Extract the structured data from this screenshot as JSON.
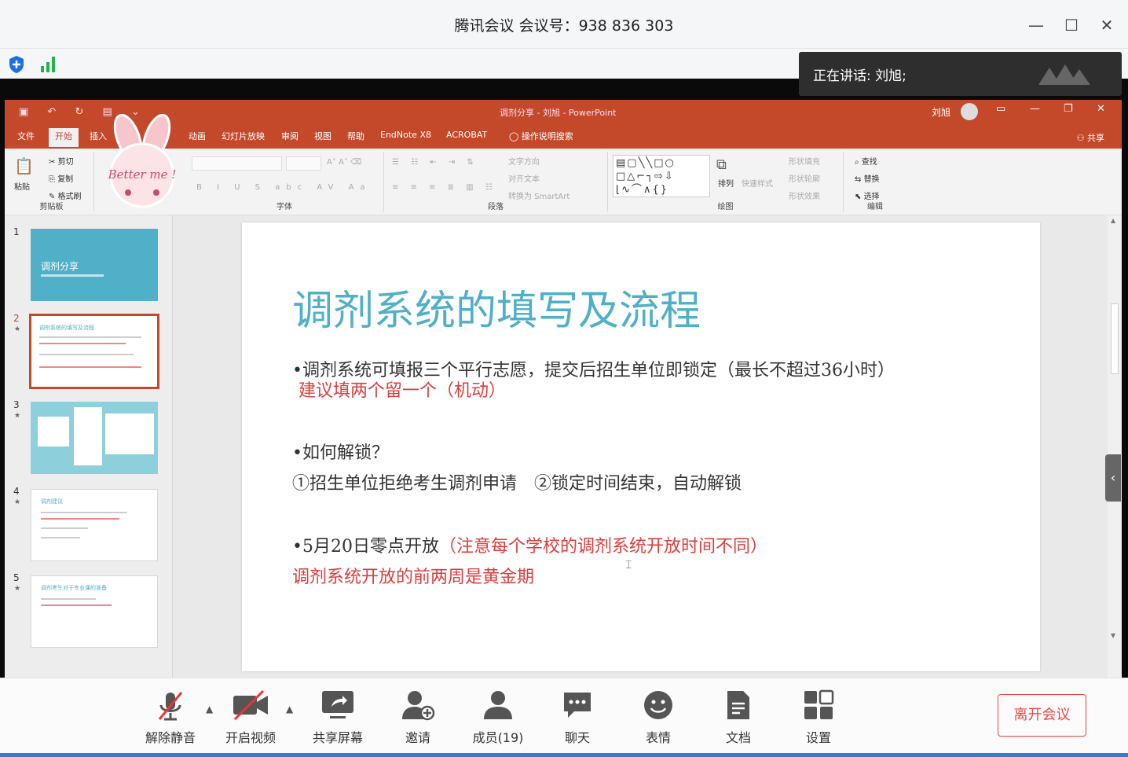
{
  "window": {
    "title": "腾讯会议 会议号：938 836 303",
    "speaker": "正在讲话: 刘旭;"
  },
  "ppt": {
    "doc_title": "调剂分享 - 刘旭 - PowerPoint",
    "user": "刘旭",
    "share": "共享",
    "tabs": [
      "文件",
      "开始",
      "插入",
      "动画",
      "幻灯片放映",
      "审阅",
      "视图",
      "帮助",
      "EndNote X8",
      "ACROBAT",
      "操作说明搜索"
    ],
    "ribbon": {
      "clipboard": {
        "label": "剪贴板",
        "paste": "粘贴",
        "cut": "剪切",
        "copy": "复制",
        "format_painter": "格式刷"
      },
      "font_label": "字体",
      "paragraph": {
        "label": "段落",
        "text_direction": "文字方向",
        "align_text": "对齐文本",
        "smartart": "转换为 SmartArt"
      },
      "drawing": {
        "label": "绘图",
        "arrange": "排列",
        "quick_styles": "快速样式",
        "fill": "形状填充",
        "outline": "形状轮廓",
        "effects": "形状效果"
      },
      "editing": {
        "label": "编辑",
        "find": "查找",
        "replace": "替换",
        "select": "选择"
      },
      "sticker_text": "Better me !"
    },
    "slides_panel": [
      {
        "num": "1",
        "star": "",
        "title": "调剂分享"
      },
      {
        "num": "2",
        "star": "★",
        "title": "调剂系统的填写及流程"
      },
      {
        "num": "3",
        "star": "★",
        "title": ""
      },
      {
        "num": "4",
        "star": "★",
        "title": "调剂建议"
      },
      {
        "num": "5",
        "star": "★",
        "title": "调剂考生对于专业课的准备"
      }
    ],
    "slide": {
      "heading": "调剂系统的填写及流程",
      "line1": "•调剂系统可填报三个平行志愿，提交后招生单位即锁定（最长不超过36小时）",
      "line1_red": "建议填两个留一个（机动）",
      "line2": "•如何解锁？",
      "line3": "①招生单位拒绝考生调剂申请　②锁定时间结束，自动解锁",
      "line4_a": "•5月20日零点开放",
      "line4_red": "（注意每个学校的调剂系统开放时间不同）",
      "line5_red": "调剂系统开放的前两周是黄金期"
    }
  },
  "toolbar": {
    "unmute": "解除静音",
    "start_video": "开启视频",
    "share_screen": "共享屏幕",
    "invite": "邀请",
    "members": "成员(19)",
    "chat": "聊天",
    "emoji": "表情",
    "docs": "文档",
    "settings": "设置",
    "leave": "离开会议"
  },
  "colors": {
    "ppt_accent": "#c4492b",
    "heading": "#4fb0c7",
    "emphasis_red": "#e03c3c",
    "leave_red": "#ee4444"
  }
}
